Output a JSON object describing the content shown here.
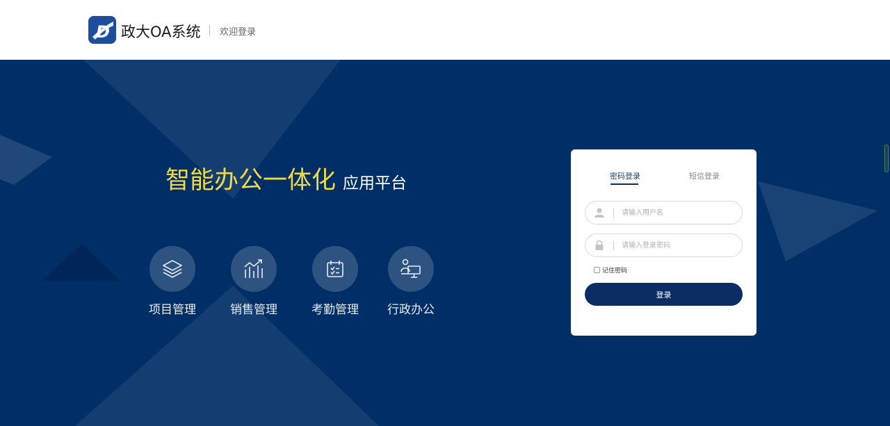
{
  "header": {
    "app_name": "政大OA系统",
    "welcome": "欢迎登录"
  },
  "hero": {
    "slogan_main": "智能办公一体化",
    "slogan_sub": "应用平台",
    "features": [
      {
        "label": "项目管理",
        "icon": "layers-icon"
      },
      {
        "label": "销售管理",
        "icon": "chart-icon"
      },
      {
        "label": "考勤管理",
        "icon": "calendar-icon"
      },
      {
        "label": "行政办公",
        "icon": "desk-user-icon"
      }
    ]
  },
  "login": {
    "tabs": [
      {
        "label": "密码登录",
        "active": true
      },
      {
        "label": "短信登录",
        "active": false
      }
    ],
    "username_placeholder": "请输入用户名",
    "password_placeholder": "请输入登录密码",
    "remember_label": "记住密码",
    "submit_label": "登录"
  },
  "colors": {
    "primary": "#002e66",
    "button": "#0c2d63",
    "accent_yellow": "#f1d945",
    "logo_blue": "#1d4e9e"
  }
}
